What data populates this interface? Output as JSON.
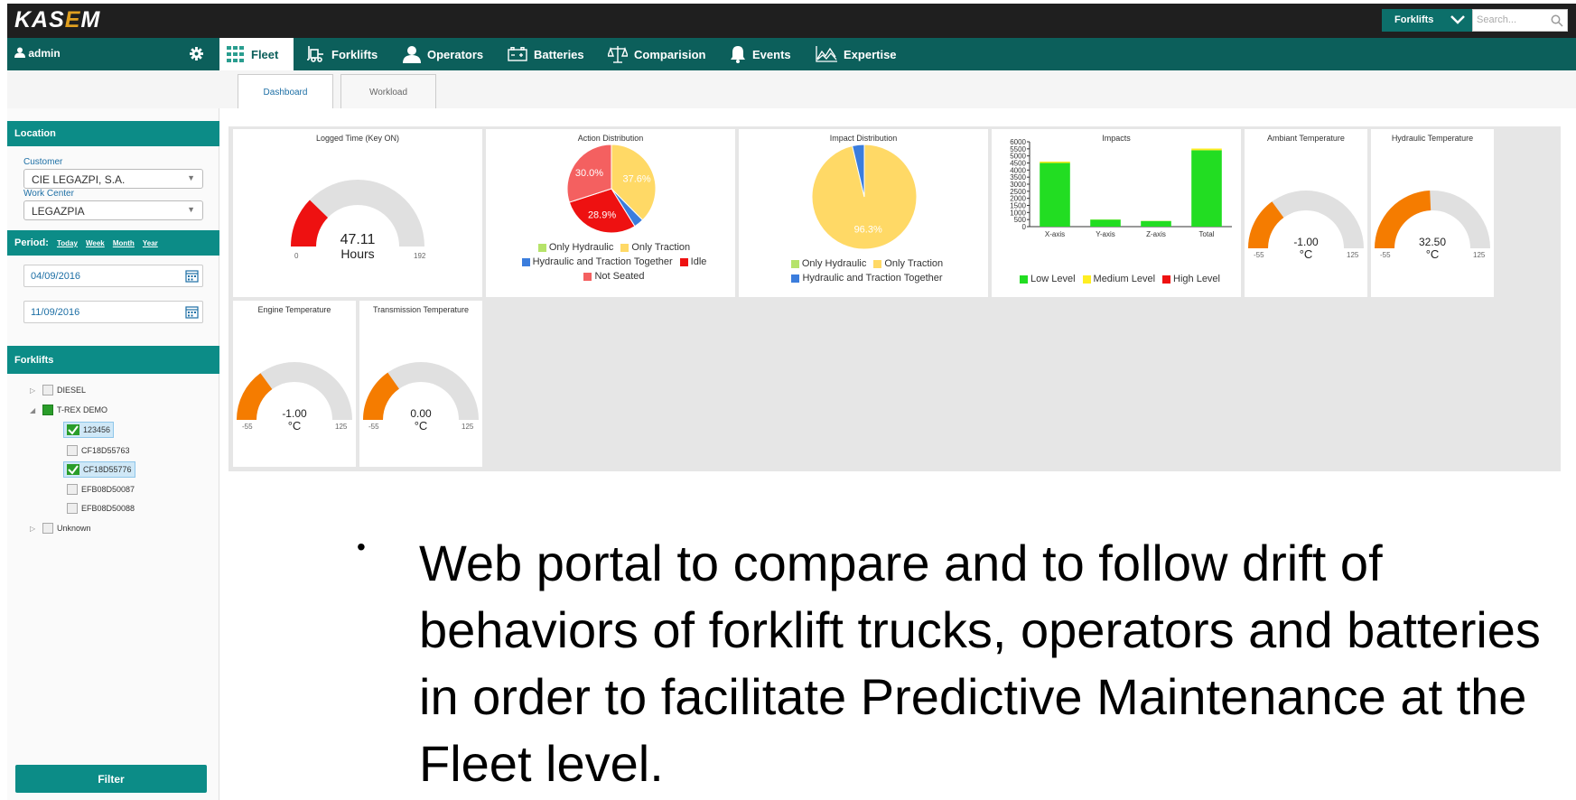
{
  "app": {
    "logo_pre": "KAS",
    "logo_c": "E",
    "logo_post": "M",
    "selector": "Forklifts",
    "search_placeholder": "Search..."
  },
  "nav": {
    "user": "admin",
    "items": [
      {
        "label": "Fleet",
        "icon": "fleet-grid-icon"
      },
      {
        "label": "Forklifts",
        "icon": "forklift-icon"
      },
      {
        "label": "Operators",
        "icon": "operator-icon"
      },
      {
        "label": "Batteries",
        "icon": "battery-icon"
      },
      {
        "label": "Comparision",
        "icon": "scale-icon"
      },
      {
        "label": "Events",
        "icon": "bell-icon"
      },
      {
        "label": "Expertise",
        "icon": "chart-line-icon"
      }
    ]
  },
  "tabs": [
    "Dashboard",
    "Workload"
  ],
  "sidebar": {
    "location_header": "Location",
    "customer_label": "Customer",
    "customer_value": "CIE LEGAZPI, S.A.",
    "workcenter_label": "Work Center",
    "workcenter_value": "LEGAZPIA",
    "period_label": "Period:",
    "period_links": [
      "Today",
      "Week",
      "Month",
      "Year"
    ],
    "date_from": "04/09/2016",
    "date_to": "11/09/2016",
    "forklifts_header": "Forklifts",
    "tree": [
      {
        "label": "DIESEL"
      },
      {
        "label": "T-REX DEMO"
      },
      {
        "label": "123456"
      },
      {
        "label": "CF18D55763"
      },
      {
        "label": "CF18D55776"
      },
      {
        "label": "EFB08D50087"
      },
      {
        "label": "EFB08D50088"
      },
      {
        "label": "Unknown"
      }
    ],
    "filter_button": "Filter"
  },
  "colors": {
    "teal": "#0c8c87",
    "dark_teal": "#0c5f5b",
    "red": "#ee1111",
    "orange": "#f57c00",
    "yellow": "#ffd966",
    "salmon": "#f46060",
    "green": "#22dd22",
    "blue": "#3b7ddd"
  },
  "chart_data": [
    {
      "type": "gauge",
      "title": "Logged Time (Key ON)",
      "value": 47.11,
      "value_label": "47.11",
      "unit": "Hours",
      "min": 0,
      "max": 192,
      "min_label": "0",
      "max_label": "192",
      "color": "#ee1111"
    },
    {
      "type": "pie",
      "title": "Action Distribution",
      "slices": [
        {
          "name": "Only Hydraulic",
          "value": 0.0,
          "color": "#b6e36a"
        },
        {
          "name": "Only Traction",
          "value": 37.6,
          "label": "37.6%",
          "color": "#ffd966"
        },
        {
          "name": "Hydraulic and Traction Together",
          "value": 3.6,
          "color": "#3b7ddd"
        },
        {
          "name": "Idle",
          "value": 28.9,
          "label": "28.9%",
          "color": "#ee1111"
        },
        {
          "name": "Not Seated",
          "value": 30.0,
          "label": "30.0%",
          "color": "#f46060"
        }
      ]
    },
    {
      "type": "pie",
      "title": "Impact Distribution",
      "slices": [
        {
          "name": "Only Hydraulic",
          "value": 0.0,
          "color": "#b6e36a"
        },
        {
          "name": "Only Traction",
          "value": 96.3,
          "label": "96.3%",
          "color": "#ffd966"
        },
        {
          "name": "Hydraulic and Traction Together",
          "value": 3.7,
          "color": "#3b7ddd"
        }
      ]
    },
    {
      "type": "bar",
      "title": "Impacts",
      "categories": [
        "X-axis",
        "Y-axis",
        "Z-axis",
        "Total"
      ],
      "series": [
        {
          "name": "Low Level",
          "values": [
            4500,
            500,
            400,
            5400
          ],
          "color": "#22dd22"
        },
        {
          "name": "Medium Level",
          "values": [
            100,
            10,
            10,
            120
          ],
          "color": "#ffee22"
        },
        {
          "name": "High Level",
          "values": [
            0,
            0,
            0,
            0
          ],
          "color": "#ee1111"
        }
      ],
      "ylim": [
        0,
        6000
      ],
      "yticks": [
        "6000",
        "5500",
        "5000",
        "4500",
        "4000",
        "3500",
        "3000",
        "2500",
        "2000",
        "1500",
        "1000",
        "500",
        "0"
      ]
    },
    {
      "type": "gauge",
      "title": "Ambiant Temperature",
      "value": -1.0,
      "value_label": "-1.00",
      "unit": "°C",
      "min": -55,
      "max": 125,
      "min_label": "-55",
      "max_label": "125",
      "color": "#f57c00"
    },
    {
      "type": "gauge",
      "title": "Hydraulic Temperature",
      "value": 32.5,
      "value_label": "32.50",
      "unit": "°C",
      "min": -55,
      "max": 125,
      "min_label": "-55",
      "max_label": "125",
      "color": "#f57c00"
    },
    {
      "type": "gauge",
      "title": "Engine Temperature",
      "value": -1.0,
      "value_label": "-1.00",
      "unit": "°C",
      "min": -55,
      "max": 125,
      "min_label": "-55",
      "max_label": "125",
      "color": "#f57c00"
    },
    {
      "type": "gauge",
      "title": "Transmission Temperature",
      "value": 0.0,
      "value_label": "0.00",
      "unit": "°C",
      "min": -55,
      "max": 125,
      "min_label": "-55",
      "max_label": "125",
      "color": "#f57c00"
    }
  ],
  "caption": "Web portal to compare and to follow drift of behaviors of forklift trucks, operators and batteries in order to facilitate Predictive Maintenance at the Fleet level."
}
